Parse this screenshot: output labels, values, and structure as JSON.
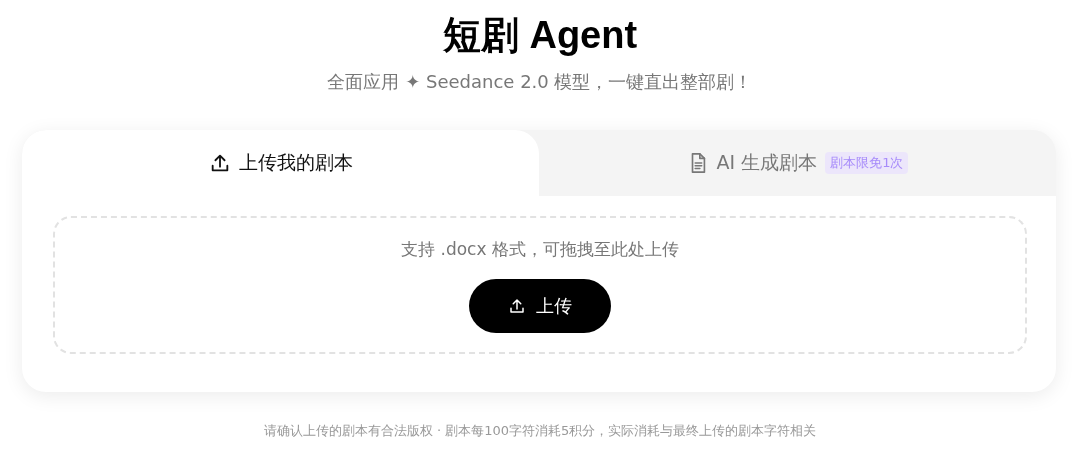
{
  "header": {
    "title": "短剧 Agent",
    "subtitle": "全面应用 ✦ Seedance 2.0 模型，一键直出整部剧！"
  },
  "tabs": [
    {
      "label": "上传我的剧本",
      "kind": "upload",
      "selected": true
    },
    {
      "label": "AI 生成剧本",
      "kind": "document",
      "badge": "剧本限免1次",
      "selected": false
    }
  ],
  "dropzone": {
    "hint": "支持 .docx 格式，可拖拽至此处上传",
    "button": "上传"
  },
  "footer": "请确认上传的剧本有合法版权 · 剧本每100字符消耗5积分，实际消耗与最终上传的剧本字符相关"
}
